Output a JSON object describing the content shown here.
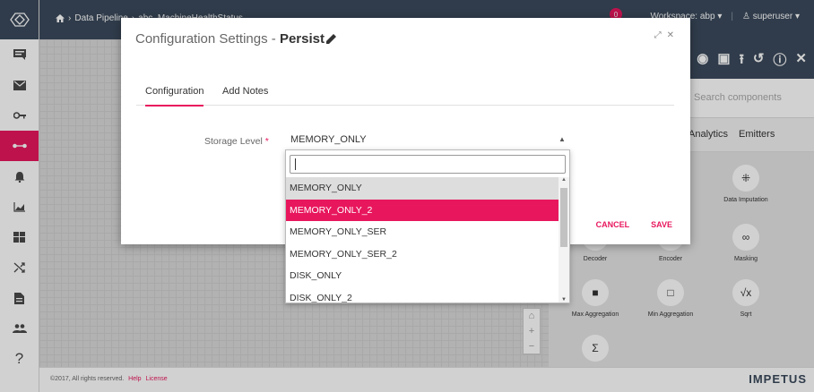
{
  "topbar": {
    "breadcrumb_home": "Data Pipeline",
    "breadcrumb_current": "abc_MachineHealthStatus",
    "notification_count": "0",
    "workspace": "Workspace: abp",
    "user": "superuser"
  },
  "right_panel": {
    "search_placeholder": "Search components",
    "tab_analytics": "Analytics",
    "tab_emitters": "Emitters",
    "components": [
      {
        "label": "Data Imputation",
        "icon": "data-imputation-icon"
      },
      {
        "label": "Decoder",
        "icon": "decoder-icon"
      },
      {
        "label": "Encoder",
        "icon": "encoder-icon"
      },
      {
        "label": "Masking",
        "icon": "masking-icon"
      },
      {
        "label": "Max Aggregation",
        "icon": "max-aggregation-icon"
      },
      {
        "label": "Min Aggregation",
        "icon": "min-aggregation-icon"
      },
      {
        "label": "Sqrt",
        "icon": "sqrt-icon"
      },
      {
        "label": "",
        "icon": "sum-icon"
      }
    ]
  },
  "modal": {
    "title_prefix": "Configuration Settings -",
    "title_name": "Persist",
    "tabs": [
      "Configuration",
      "Add Notes"
    ],
    "field_label": "Storage Level",
    "field_required_mark": "*",
    "selected_value": "MEMORY_ONLY",
    "cancel_label": "CANCEL",
    "save_label": "SAVE"
  },
  "dropdown": {
    "search_value": "",
    "options": [
      "MEMORY_ONLY",
      "MEMORY_ONLY_2",
      "MEMORY_ONLY_SER",
      "MEMORY_ONLY_SER_2",
      "DISK_ONLY",
      "DISK_ONLY_2"
    ],
    "highlighted_index": 1,
    "hover_index": 0
  },
  "footer": {
    "copyright": "©2017, All rights reserved.",
    "help": "Help",
    "license": "License",
    "brand": "IMPETUS"
  },
  "colors": {
    "accent": "#e8175d",
    "header": "#3b4a5c"
  }
}
